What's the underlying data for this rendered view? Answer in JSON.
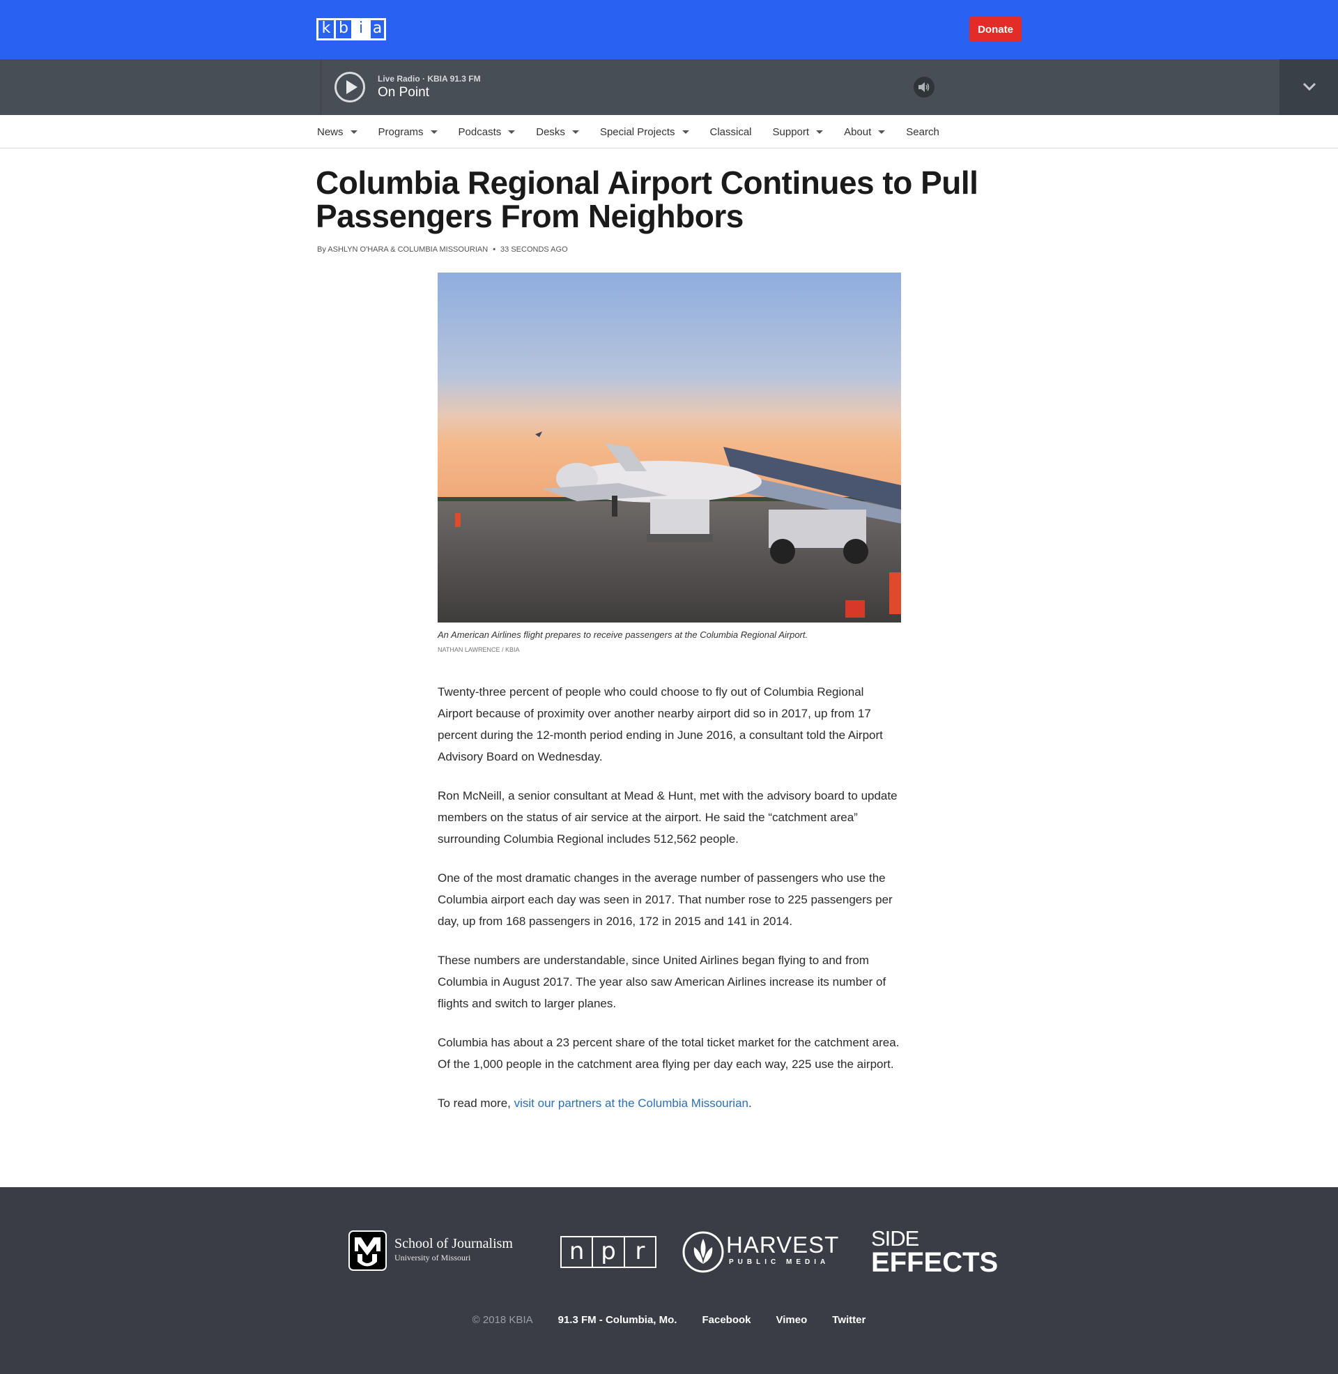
{
  "header": {
    "logo_letters": [
      "k",
      "b",
      "i",
      "a"
    ],
    "donate_label": "Donate"
  },
  "player": {
    "station": "Live Radio · KBIA 91.3 FM",
    "program": "On Point"
  },
  "nav": {
    "items": [
      {
        "label": "News"
      },
      {
        "label": "Programs"
      },
      {
        "label": "Podcasts"
      },
      {
        "label": "Desks"
      },
      {
        "label": "Special Projects"
      },
      {
        "label": "Classical"
      },
      {
        "label": "Support"
      },
      {
        "label": "About"
      },
      {
        "label": "Search"
      }
    ]
  },
  "article": {
    "headline": "Columbia Regional Airport Continues to Pull Passengers From Neighbors",
    "byline": "By ASHLYN O'HARA & COLUMBIA MISSOURIAN",
    "time": "33 SECONDS AGO",
    "caption": "An American Airlines flight prepares to receive passengers at the Columbia Regional Airport.",
    "credit": "NATHAN LAWRENCE / KBIA",
    "paragraphs": [
      "Twenty-three percent of people who could choose to fly out of Columbia Regional Airport because of proximity over another nearby airport did so in 2017, up from 17 percent during the 12-month period ending in June 2016, a consultant told the Airport Advisory Board on Wednesday.",
      "Ron McNeill, a senior consultant at Mead & Hunt, met with the advisory board to update members on the status of air service at the airport. He said the “catchment area” surrounding Columbia Regional includes 512,562 people.",
      "One of the most dramatic changes in the average number of passengers who use the Columbia airport each day was seen in 2017. That number rose to 225 passengers per day, up from 168 passengers in 2016, 172 in 2015 and 141 in 2014.",
      "These numbers are understandable, since United Airlines began flying to and from Columbia in August 2017. The year also saw American Airlines increase its number of flights and switch to larger planes.",
      "Columbia has about a 23 percent share of the total ticket market for the catchment area. Of the 1,000 people in the catchment area flying per day each way, 225 use the airport."
    ],
    "read_more_prefix": "To read more, ",
    "read_more_link": "visit our partners at the Columbia Missourian",
    "read_more_suffix": "."
  },
  "footer": {
    "mu_title": "School of Journalism",
    "mu_subtitle": "University of Missouri",
    "npr_letters": [
      "n",
      "p",
      "r"
    ],
    "harvest_title": "HARVEST",
    "harvest_subtitle": "PUBLIC MEDIA",
    "side_line1": "SIDE",
    "side_line2": "EFFECTS",
    "copyright": "© 2018 KBIA",
    "links": [
      "91.3 FM - Columbia, Mo.",
      "Facebook",
      "Vimeo",
      "Twitter"
    ]
  }
}
